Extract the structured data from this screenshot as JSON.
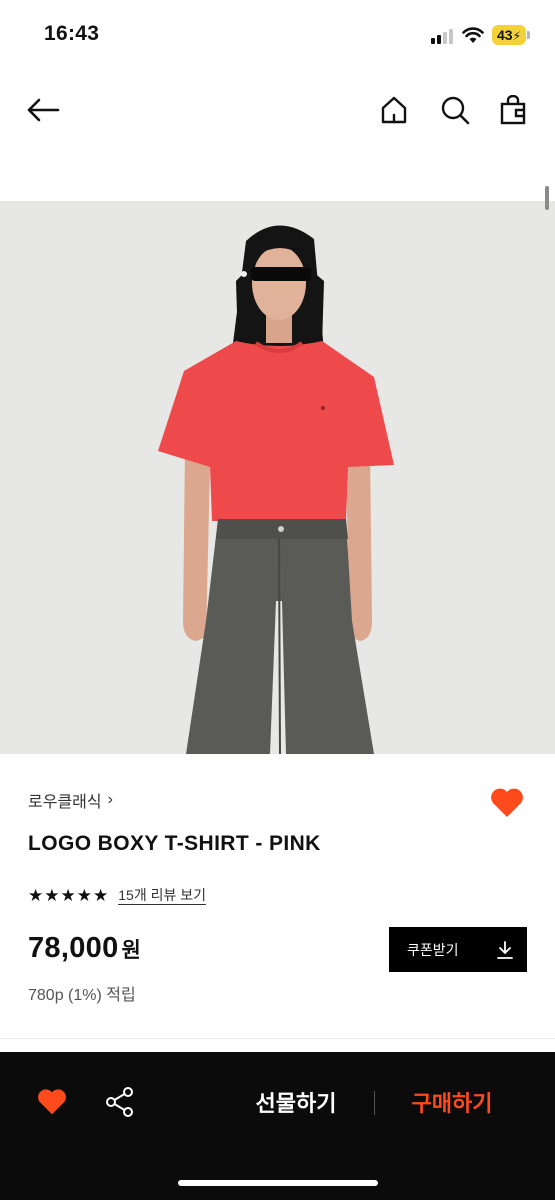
{
  "status_bar": {
    "time": "16:43",
    "battery": "43",
    "icons": [
      "cellular-signal-icon",
      "wifi-icon",
      "battery-charging-icon"
    ]
  },
  "nav": {
    "icons": [
      "back-arrow-icon",
      "home-icon",
      "search-icon",
      "shopping-bag-icon"
    ]
  },
  "hero": {
    "description_icon": "product-photo-model-icon"
  },
  "product": {
    "brand": "로우클래식",
    "brand_chevron": "›",
    "name": "LOGO BOXY T-SHIRT - PINK",
    "rating_stars": 5,
    "review_link": "15개 리뷰 보기",
    "price": "78,000",
    "price_unit": "원",
    "points": "780p (1%) 적립",
    "coupon_label": "쿠폰받기",
    "wishlisted": true
  },
  "bottom_bar": {
    "gift_label": "선물하기",
    "buy_label": "구매하기"
  },
  "colors": {
    "accent": "#ff4a1c",
    "battery": "#f3d13b",
    "bottom_bar_bg": "#0b0b0b",
    "tshirt": "#ee4a4b",
    "jeans": "#5a5a56"
  }
}
